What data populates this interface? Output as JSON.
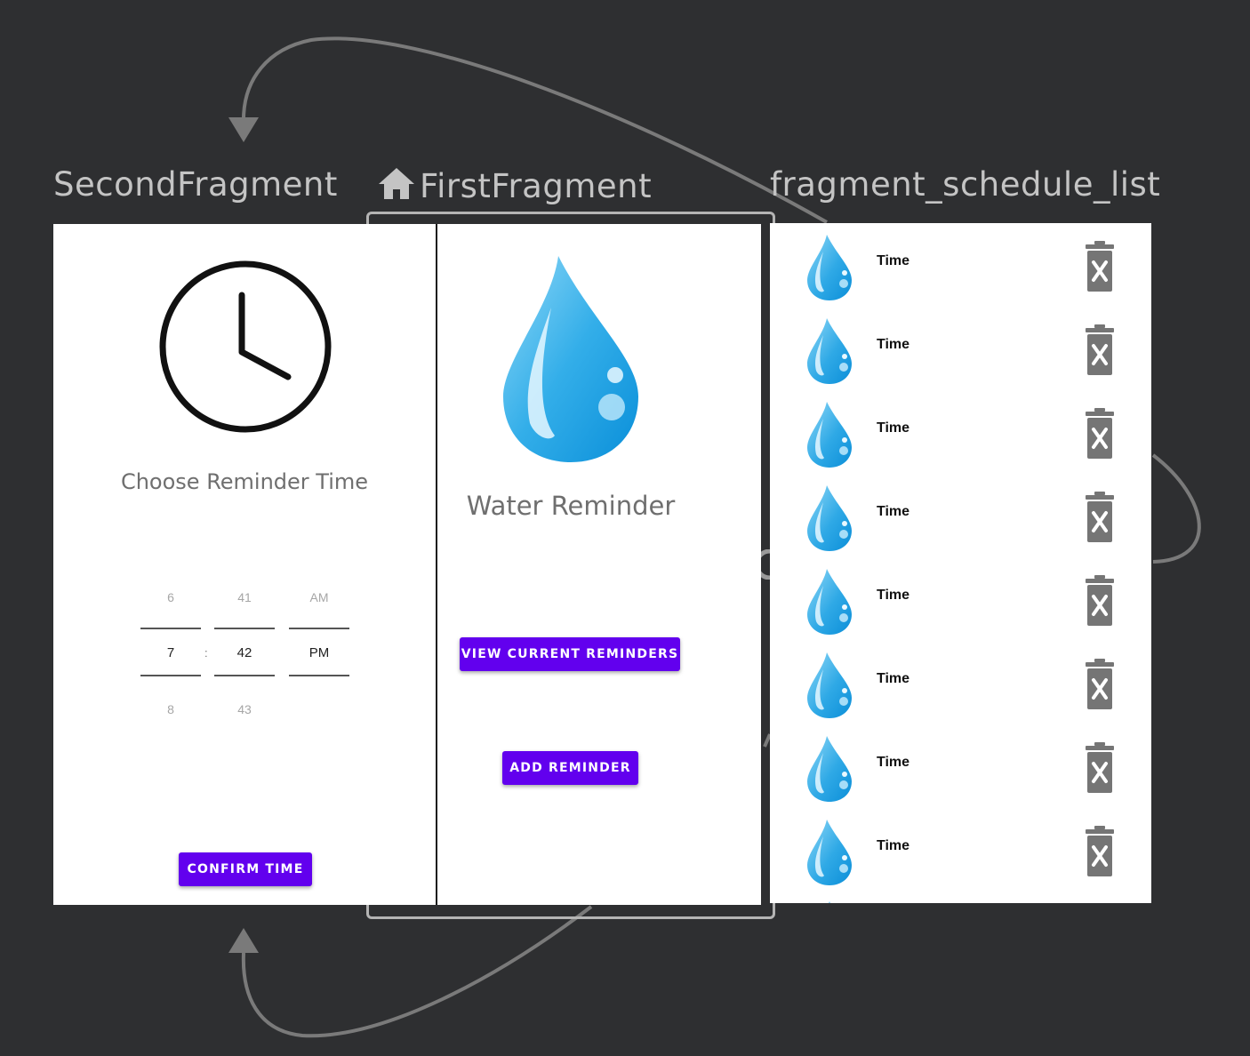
{
  "fragments": {
    "second": {
      "title": "SecondFragment",
      "heading": "Choose Reminder Time",
      "picker": {
        "hours": {
          "prev": "6",
          "selected": "7",
          "next": "8"
        },
        "minutes": {
          "prev": "41",
          "selected": "42",
          "next": "43"
        },
        "ampm": {
          "prev": "AM",
          "selected": "PM"
        },
        "separator": ":"
      },
      "confirm_label": "CONFIRM TIME"
    },
    "first": {
      "title": "FirstFragment",
      "heading": "Water Reminder",
      "view_label": "VIEW CURRENT REMINDERS",
      "add_label": "ADD REMINDER"
    },
    "schedule": {
      "title": "fragment_schedule_list",
      "rows": [
        {
          "time": "Time"
        },
        {
          "time": "Time"
        },
        {
          "time": "Time"
        },
        {
          "time": "Time"
        },
        {
          "time": "Time"
        },
        {
          "time": "Time"
        },
        {
          "time": "Time"
        },
        {
          "time": "Time"
        }
      ]
    }
  },
  "icons": {
    "start": "home-icon",
    "clock": "clock-icon",
    "drop": "water-drop-icon",
    "delete": "trash-icon"
  },
  "colors": {
    "canvas": "#2e2f31",
    "accent": "#6200ee",
    "arrow": "#7a7a7a",
    "title": "#c4c4c4"
  }
}
